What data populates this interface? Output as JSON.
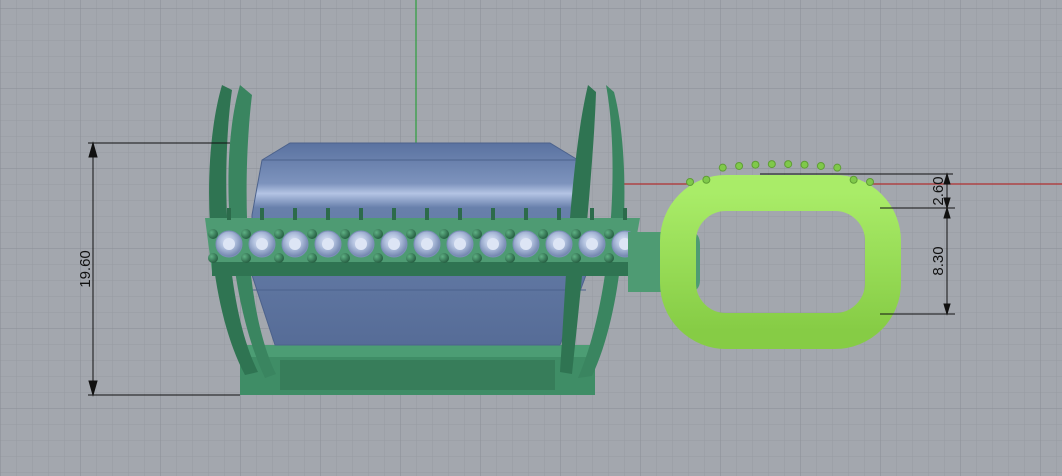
{
  "viewport": {
    "background": "#a3a7ae",
    "axis_x_color": "#b03030",
    "axis_y_color": "#2e9e3e"
  },
  "dimensions": {
    "total_height": "19.60",
    "loop_top": "2.60",
    "loop_inner": "8.30"
  },
  "colors": {
    "metal": "#3f8d66",
    "metal_dark": "#2c6b4b",
    "gem_body": "#6d84ad",
    "gem_light": "#aebfe0",
    "loop": "#9be35b"
  }
}
